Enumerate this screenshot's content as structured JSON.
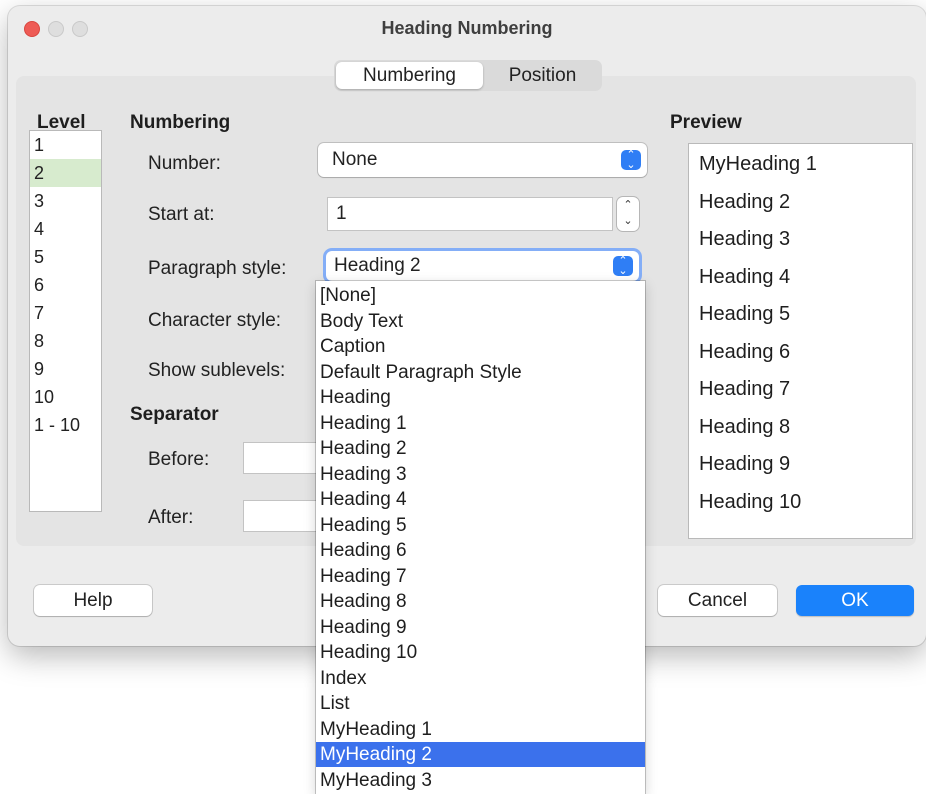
{
  "window": {
    "title": "Heading Numbering"
  },
  "tabs": [
    {
      "label": "Numbering",
      "active": true
    },
    {
      "label": "Position",
      "active": false
    }
  ],
  "level": {
    "header": "Level",
    "items": [
      "1",
      "2",
      "3",
      "4",
      "5",
      "6",
      "7",
      "8",
      "9",
      "10",
      "1 - 10"
    ],
    "selected": "2"
  },
  "numbering": {
    "header": "Numbering",
    "number_label": "Number:",
    "number_value": "None",
    "start_at_label": "Start at:",
    "start_at_value": "1",
    "paragraph_style_label": "Paragraph style:",
    "paragraph_style_value": "Heading 2",
    "character_style_label": "Character style:",
    "show_sublevels_label": "Show sublevels:"
  },
  "separator": {
    "header": "Separator",
    "before_label": "Before:",
    "after_label": "After:"
  },
  "preview": {
    "header": "Preview",
    "items": [
      "MyHeading 1",
      "Heading 2",
      "Heading 3",
      "Heading 4",
      "Heading 5",
      "Heading 6",
      "Heading 7",
      "Heading 8",
      "Heading 9",
      "Heading 10"
    ]
  },
  "dropdown": {
    "options": [
      "[None]",
      "Body Text",
      "Caption",
      "Default Paragraph Style",
      "Heading",
      "Heading 1",
      "Heading 2",
      "Heading 3",
      "Heading 4",
      "Heading 5",
      "Heading 6",
      "Heading 7",
      "Heading 8",
      "Heading 9",
      "Heading 10",
      "Index",
      "List",
      "MyHeading 1",
      "MyHeading 2",
      "MyHeading 3"
    ],
    "highlighted": "MyHeading 2"
  },
  "buttons": {
    "help": "Help",
    "cancel": "Cancel",
    "ok": "OK"
  },
  "colors": {
    "accent": "#1a82fb",
    "highlight": "#3b71ec",
    "level_selected": "#d7ebce",
    "close": "#ee5b55"
  }
}
